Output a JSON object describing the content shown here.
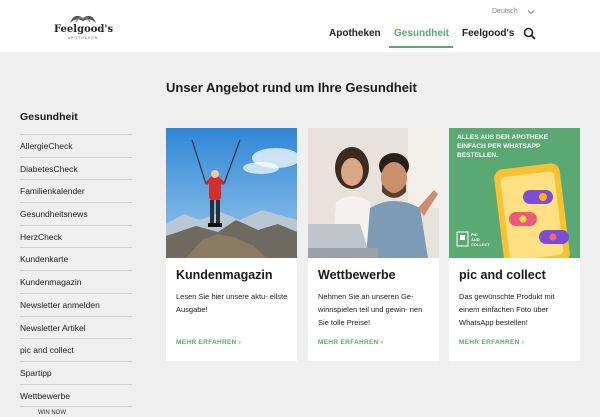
{
  "header": {
    "logo_text": "Feelgood's",
    "logo_sub": "APOTHEKEN",
    "language": "Deutsch",
    "nav": [
      {
        "label": "Apotheken"
      },
      {
        "label": "Gesundheit"
      },
      {
        "label": "Feelgood's"
      }
    ]
  },
  "main": {
    "title": "Unser Angebot rund um Ihre Gesundheit"
  },
  "sidebar": {
    "title": "Gesundheit",
    "items": [
      "AllergieCheck",
      "DiabetesCheck",
      "Familienkalender",
      "Gesundheitsnews",
      "HerzCheck",
      "Kundenkarte",
      "Kundenmagazin",
      "Newsletter anmelden",
      "Newsletter Artikel",
      "pic and collect",
      "Spartipp",
      "Wettbewerbe"
    ],
    "sub_item": "WIN NOW"
  },
  "cards": [
    {
      "title": "Kundenmagazin",
      "text": "Lesen Sie hier unsere aktu- ellste Ausgabe!",
      "more": "MEHR ERFAHREN ›"
    },
    {
      "title": "Wettbewerbe",
      "text": "Nehmen Sie an unseren Ge- winnspielen teil und gewin- nen Sie tolle Preise!",
      "more": "MEHR ERFAHREN ›"
    },
    {
      "title": "pic and collect",
      "text": "Das gewünschte Produkt mit einem einfachen Foto über WhatsApp bestellen!",
      "more": "MEHR ERFAHREN ›"
    }
  ],
  "promo": {
    "headline_1": "ALLES AUS DER APOTHEKE",
    "headline_2": "EINFACH PER WHATSAPP",
    "headline_3": "BESTELLEN.",
    "badge_1": "PIC",
    "badge_2": "AND",
    "badge_3": "COLLECT"
  },
  "colors": {
    "accent": "#5aa972",
    "background": "#efefef"
  }
}
